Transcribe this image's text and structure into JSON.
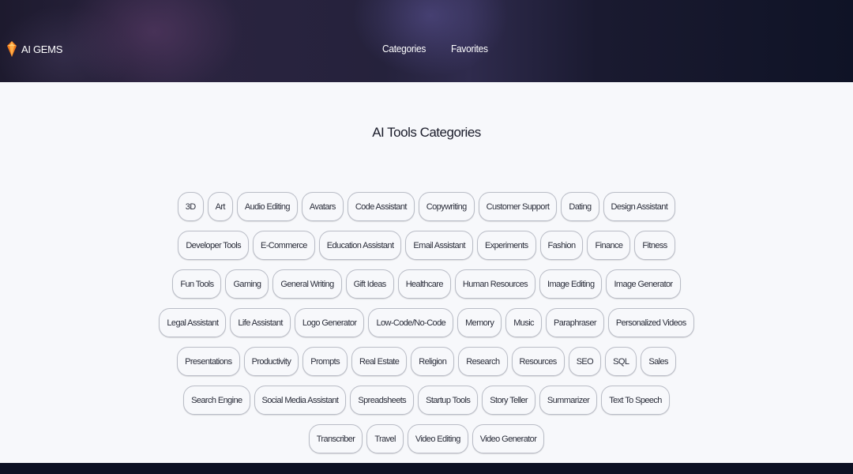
{
  "header": {
    "brand": "AI GEMS",
    "logo_icon": "gem-icon",
    "nav": [
      "Categories",
      "Favorites"
    ]
  },
  "main": {
    "title": "AI Tools Categories",
    "categories": [
      "3D",
      "Art",
      "Audio Editing",
      "Avatars",
      "Code Assistant",
      "Copywriting",
      "Customer Support",
      "Dating",
      "Design Assistant",
      "Developer Tools",
      "E-Commerce",
      "Education Assistant",
      "Email Assistant",
      "Experiments",
      "Fashion",
      "Finance",
      "Fitness",
      "Fun Tools",
      "Gaming",
      "General Writing",
      "Gift Ideas",
      "Healthcare",
      "Human Resources",
      "Image Editing",
      "Image Generator",
      "Legal Assistant",
      "Life Assistant",
      "Logo Generator",
      "Low-Code/No-Code",
      "Memory",
      "Music",
      "Paraphraser",
      "Personalized Videos",
      "Presentations",
      "Productivity",
      "Prompts",
      "Real Estate",
      "Religion",
      "Research",
      "Resources",
      "SEO",
      "SQL",
      "Sales",
      "Search Engine",
      "Social Media Assistant",
      "Spreadsheets",
      "Startup Tools",
      "Story Teller",
      "Summarizer",
      "Text To Speech",
      "Transcriber",
      "Travel",
      "Video Editing",
      "Video Generator"
    ]
  },
  "colors": {
    "header_dark": "#1d1a2e",
    "page_bg": "#f7f8fb",
    "tag_border": "#b9bcc6",
    "footer": "#0c1022",
    "logo_orange": "#f07a1a"
  }
}
